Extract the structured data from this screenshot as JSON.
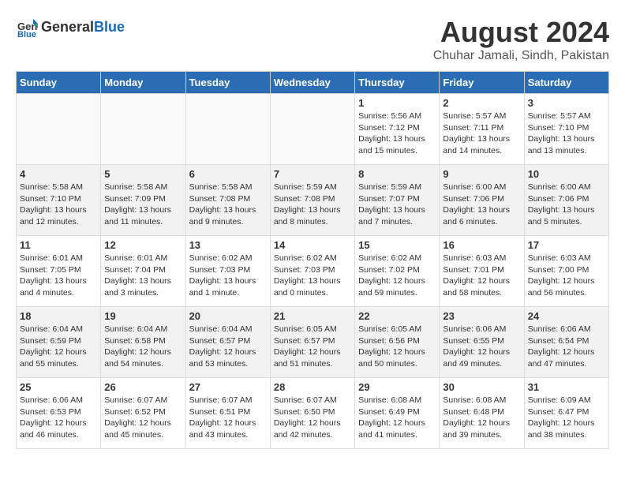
{
  "header": {
    "logo_general": "General",
    "logo_blue": "Blue",
    "title": "August 2024",
    "subtitle": "Chuhar Jamali, Sindh, Pakistan"
  },
  "weekdays": [
    "Sunday",
    "Monday",
    "Tuesday",
    "Wednesday",
    "Thursday",
    "Friday",
    "Saturday"
  ],
  "weeks": [
    [
      {
        "day": "",
        "content": ""
      },
      {
        "day": "",
        "content": ""
      },
      {
        "day": "",
        "content": ""
      },
      {
        "day": "",
        "content": ""
      },
      {
        "day": "1",
        "content": "Sunrise: 5:56 AM\nSunset: 7:12 PM\nDaylight: 13 hours\nand 15 minutes."
      },
      {
        "day": "2",
        "content": "Sunrise: 5:57 AM\nSunset: 7:11 PM\nDaylight: 13 hours\nand 14 minutes."
      },
      {
        "day": "3",
        "content": "Sunrise: 5:57 AM\nSunset: 7:10 PM\nDaylight: 13 hours\nand 13 minutes."
      }
    ],
    [
      {
        "day": "4",
        "content": "Sunrise: 5:58 AM\nSunset: 7:10 PM\nDaylight: 13 hours\nand 12 minutes."
      },
      {
        "day": "5",
        "content": "Sunrise: 5:58 AM\nSunset: 7:09 PM\nDaylight: 13 hours\nand 11 minutes."
      },
      {
        "day": "6",
        "content": "Sunrise: 5:58 AM\nSunset: 7:08 PM\nDaylight: 13 hours\nand 9 minutes."
      },
      {
        "day": "7",
        "content": "Sunrise: 5:59 AM\nSunset: 7:08 PM\nDaylight: 13 hours\nand 8 minutes."
      },
      {
        "day": "8",
        "content": "Sunrise: 5:59 AM\nSunset: 7:07 PM\nDaylight: 13 hours\nand 7 minutes."
      },
      {
        "day": "9",
        "content": "Sunrise: 6:00 AM\nSunset: 7:06 PM\nDaylight: 13 hours\nand 6 minutes."
      },
      {
        "day": "10",
        "content": "Sunrise: 6:00 AM\nSunset: 7:06 PM\nDaylight: 13 hours\nand 5 minutes."
      }
    ],
    [
      {
        "day": "11",
        "content": "Sunrise: 6:01 AM\nSunset: 7:05 PM\nDaylight: 13 hours\nand 4 minutes."
      },
      {
        "day": "12",
        "content": "Sunrise: 6:01 AM\nSunset: 7:04 PM\nDaylight: 13 hours\nand 3 minutes."
      },
      {
        "day": "13",
        "content": "Sunrise: 6:02 AM\nSunset: 7:03 PM\nDaylight: 13 hours\nand 1 minute."
      },
      {
        "day": "14",
        "content": "Sunrise: 6:02 AM\nSunset: 7:03 PM\nDaylight: 13 hours\nand 0 minutes."
      },
      {
        "day": "15",
        "content": "Sunrise: 6:02 AM\nSunset: 7:02 PM\nDaylight: 12 hours\nand 59 minutes."
      },
      {
        "day": "16",
        "content": "Sunrise: 6:03 AM\nSunset: 7:01 PM\nDaylight: 12 hours\nand 58 minutes."
      },
      {
        "day": "17",
        "content": "Sunrise: 6:03 AM\nSunset: 7:00 PM\nDaylight: 12 hours\nand 56 minutes."
      }
    ],
    [
      {
        "day": "18",
        "content": "Sunrise: 6:04 AM\nSunset: 6:59 PM\nDaylight: 12 hours\nand 55 minutes."
      },
      {
        "day": "19",
        "content": "Sunrise: 6:04 AM\nSunset: 6:58 PM\nDaylight: 12 hours\nand 54 minutes."
      },
      {
        "day": "20",
        "content": "Sunrise: 6:04 AM\nSunset: 6:57 PM\nDaylight: 12 hours\nand 53 minutes."
      },
      {
        "day": "21",
        "content": "Sunrise: 6:05 AM\nSunset: 6:57 PM\nDaylight: 12 hours\nand 51 minutes."
      },
      {
        "day": "22",
        "content": "Sunrise: 6:05 AM\nSunset: 6:56 PM\nDaylight: 12 hours\nand 50 minutes."
      },
      {
        "day": "23",
        "content": "Sunrise: 6:06 AM\nSunset: 6:55 PM\nDaylight: 12 hours\nand 49 minutes."
      },
      {
        "day": "24",
        "content": "Sunrise: 6:06 AM\nSunset: 6:54 PM\nDaylight: 12 hours\nand 47 minutes."
      }
    ],
    [
      {
        "day": "25",
        "content": "Sunrise: 6:06 AM\nSunset: 6:53 PM\nDaylight: 12 hours\nand 46 minutes."
      },
      {
        "day": "26",
        "content": "Sunrise: 6:07 AM\nSunset: 6:52 PM\nDaylight: 12 hours\nand 45 minutes."
      },
      {
        "day": "27",
        "content": "Sunrise: 6:07 AM\nSunset: 6:51 PM\nDaylight: 12 hours\nand 43 minutes."
      },
      {
        "day": "28",
        "content": "Sunrise: 6:07 AM\nSunset: 6:50 PM\nDaylight: 12 hours\nand 42 minutes."
      },
      {
        "day": "29",
        "content": "Sunrise: 6:08 AM\nSunset: 6:49 PM\nDaylight: 12 hours\nand 41 minutes."
      },
      {
        "day": "30",
        "content": "Sunrise: 6:08 AM\nSunset: 6:48 PM\nDaylight: 12 hours\nand 39 minutes."
      },
      {
        "day": "31",
        "content": "Sunrise: 6:09 AM\nSunset: 6:47 PM\nDaylight: 12 hours\nand 38 minutes."
      }
    ]
  ]
}
